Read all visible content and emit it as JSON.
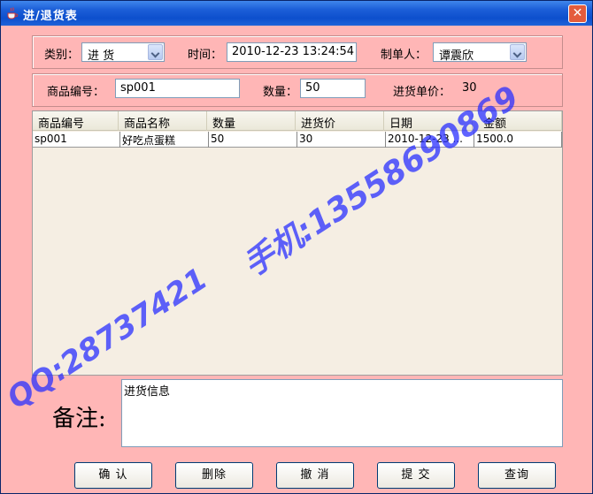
{
  "window": {
    "title": "进/退货表"
  },
  "row1": {
    "category_label": "类别：",
    "category_value": "进  货",
    "time_label": "时间：",
    "time_value": "2010-12-23 13:24:54",
    "maker_label": "制单人：",
    "maker_value": "谭震欣"
  },
  "row2": {
    "code_label": "商品编号：",
    "code_value": "sp001",
    "qty_label": "数量：",
    "qty_value": "50",
    "price_label": "进货单价：",
    "price_value": "30"
  },
  "table": {
    "columns": [
      "商品编号",
      "商品名称",
      "数量",
      "进货价",
      "日期",
      "金额"
    ],
    "rows": [
      [
        "sp001",
        "好吃点蛋糕",
        "50",
        "30",
        "2010-12-23 ...",
        "1500.0"
      ]
    ]
  },
  "remark": {
    "label": "备注:",
    "value": "进货信息"
  },
  "buttons": {
    "confirm": "确  认",
    "delete": "删除",
    "cancel": "撤  消",
    "submit": "提  交",
    "query": "查询"
  },
  "watermark": {
    "qq": "QQ:28737421",
    "phone": "手机:13558690869"
  },
  "colors": {
    "background": "#ffb6b6",
    "titlebar": "#0d4fcd",
    "watermark": "#2a30ff"
  }
}
